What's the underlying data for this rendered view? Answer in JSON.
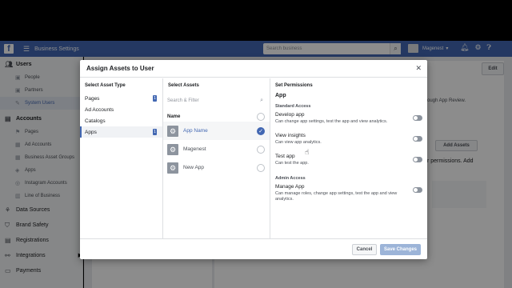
{
  "topbar": {
    "title": "Business Settings",
    "search_placeholder": "Search business",
    "account_name": "Magenest"
  },
  "sidebar": {
    "users_heading": "Users",
    "users_items": [
      {
        "label": "People",
        "icon": "person-icon"
      },
      {
        "label": "Partners",
        "icon": "briefcase-icon"
      },
      {
        "label": "System Users",
        "icon": "wrench-icon",
        "active": true
      }
    ],
    "accounts_heading": "Accounts",
    "accounts_items": [
      {
        "label": "Pages",
        "icon": "flag-icon"
      },
      {
        "label": "Ad Accounts",
        "icon": "ad-icon"
      },
      {
        "label": "Business Asset Groups",
        "icon": "group-icon"
      },
      {
        "label": "Apps",
        "icon": "cube-icon"
      },
      {
        "label": "Instagram Accounts",
        "icon": "instagram-icon"
      },
      {
        "label": "Line of Business",
        "icon": "building-icon"
      }
    ],
    "other_items": [
      {
        "label": "Data Sources"
      },
      {
        "label": "Brand Safety"
      },
      {
        "label": "Registrations"
      },
      {
        "label": "Integrations"
      },
      {
        "label": "Payments"
      }
    ]
  },
  "background": {
    "edit_label": "Edit",
    "text1": "ough App Review.",
    "add_assets_label": "Add Assets",
    "text2": "r permissions. Add"
  },
  "modal": {
    "title": "Assign Assets to User",
    "asset_type_heading": "Select Asset Type",
    "asset_types": [
      {
        "label": "Pages",
        "count": "1"
      },
      {
        "label": "Ad Accounts",
        "count": ""
      },
      {
        "label": "Catalogs",
        "count": ""
      },
      {
        "label": "Apps",
        "count": "1",
        "active": true
      }
    ],
    "select_assets_heading": "Select Assets",
    "search_placeholder": "Search & Filter",
    "name_col": "Name",
    "assets": [
      {
        "label": "App Name",
        "selected": true
      },
      {
        "label": "Magenest",
        "selected": false
      },
      {
        "label": "New App",
        "selected": false
      }
    ],
    "permissions_heading": "Set Permissions",
    "permissions_app": "App",
    "standard_access": "Standard Access",
    "admin_access": "Admin Access",
    "standard_perms": [
      {
        "title": "Develop app",
        "desc": "Can change app settings, test the app and view analytics."
      },
      {
        "title": "View insights",
        "desc": "Can view app analytics."
      },
      {
        "title": "Test app",
        "desc": "Can test the app."
      }
    ],
    "admin_perms": [
      {
        "title": "Manage App",
        "desc": "Can manage roles, change app settings, test the app and view analytics."
      }
    ],
    "cancel_label": "Cancel",
    "save_label": "Save Changes"
  }
}
